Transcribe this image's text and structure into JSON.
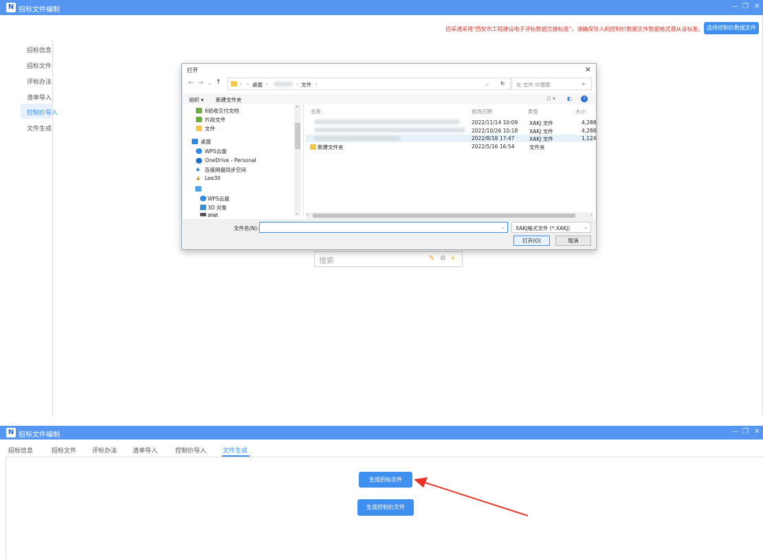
{
  "window1": {
    "title": "招标文件编制",
    "notice": "招采通采用\"西安市工程建设电子评标数据交换标准\"，请确保导入的控制价数据文件数据格式遵从该标准。",
    "select_button": "选择控制价数据文件",
    "sidebar": [
      "招标信息",
      "招标文件",
      "评标办法",
      "清单导入",
      "控制价导入",
      "文件生成"
    ],
    "active_index": 4
  },
  "dialog": {
    "title": "打开",
    "path": [
      "桌面",
      "文件"
    ],
    "search_placeholder": "在 文件 中搜索",
    "organize": "组织 ▾",
    "new_folder": "新建文件夹",
    "tree": [
      "6验收交付文档",
      "片段文件",
      "文件",
      "桌面",
      "WPS云盘",
      "OneDrive - Personal",
      "百度网盘同步空间",
      "Lee30",
      "WPS云盘",
      "3D 对象",
      "视频"
    ],
    "columns": [
      "名称",
      "修改日期",
      "类型",
      "大小"
    ],
    "files": [
      {
        "name": "",
        "date": "2022/11/14 10:09",
        "type": "XAKJ 文件",
        "size": "4,288"
      },
      {
        "name": "",
        "date": "2022/10/26 10:18",
        "type": "XAKJ 文件",
        "size": "4,288"
      },
      {
        "name": "",
        "date": "2022/8/18 17:47",
        "type": "XAKJ 文件",
        "size": "1,124"
      },
      {
        "name": "新建文件夹",
        "date": "2022/5/16 16:54",
        "type": "文件夹",
        "size": ""
      }
    ],
    "filename_label": "文件名(N):",
    "filename_value": "",
    "filetype": "XAKJ格式文件 (*.XAKJ)",
    "open_button": "打开(O)",
    "cancel_button": "取消"
  },
  "background_search": "搜索",
  "window2": {
    "title": "招标文件编制",
    "tabs": [
      "招标信息",
      "招标文件",
      "评标办法",
      "清单导入",
      "控制价导入",
      "文件生成"
    ],
    "active_tab": 5,
    "generate_bid_button": "生成招标文件",
    "generate_price_button": "生成控制价文件"
  },
  "colors": {
    "accent": "#3f8ff0",
    "titlebar": "#5596f2",
    "notice": "#d23b2f",
    "arrow": "#e8332b"
  }
}
